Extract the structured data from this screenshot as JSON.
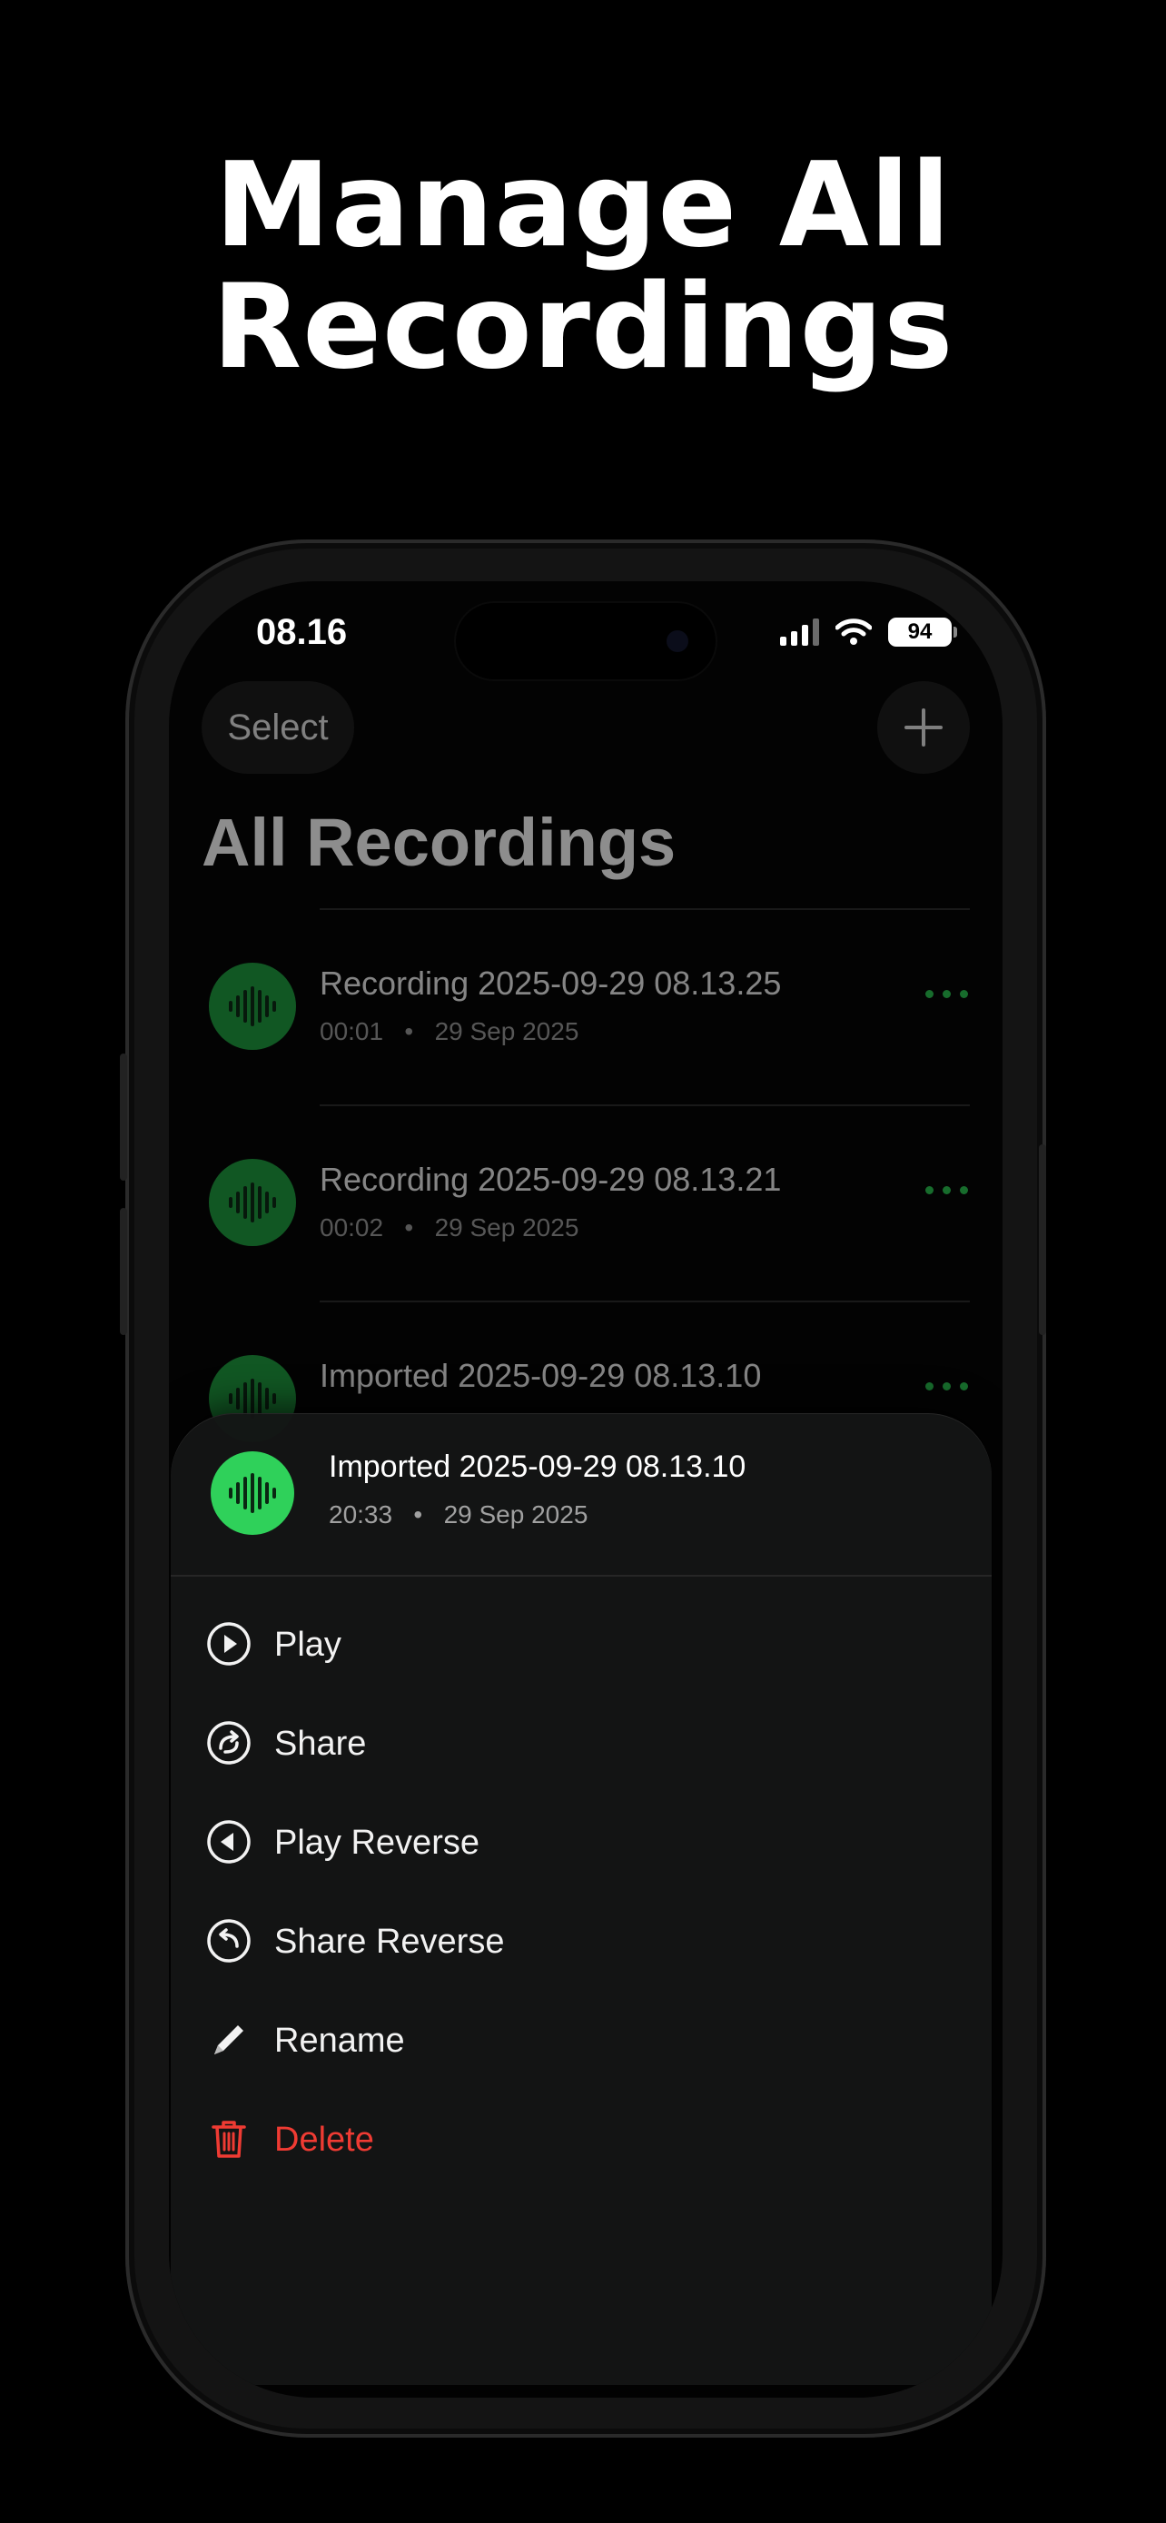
{
  "headline": {
    "line1": "Manage All",
    "line2": "Recordings"
  },
  "status_bar": {
    "time": "08.16",
    "battery": "94"
  },
  "toolbar": {
    "select_label": "Select"
  },
  "page_title": "All Recordings",
  "recordings": [
    {
      "title": "Recording 2025-09-29 08.13.25",
      "duration": "00:01",
      "separator": "•",
      "date": "29 Sep 2025"
    },
    {
      "title": "Recording 2025-09-29 08.13.21",
      "duration": "00:02",
      "separator": "•",
      "date": "29 Sep 2025"
    },
    {
      "title": "Imported 2025-09-29 08.13.10"
    }
  ],
  "context_sheet": {
    "title": "Imported 2025-09-29 08.13.10",
    "duration": "20:33",
    "separator": "•",
    "date": "29 Sep 2025",
    "actions": [
      {
        "label": "Play",
        "icon": "play-circle-icon"
      },
      {
        "label": "Share",
        "icon": "share-circle-icon"
      },
      {
        "label": "Play Reverse",
        "icon": "reverse-play-circle-icon"
      },
      {
        "label": "Share Reverse",
        "icon": "reverse-share-circle-icon"
      },
      {
        "label": "Rename",
        "icon": "pencil-icon"
      },
      {
        "label": "Delete",
        "icon": "trash-icon"
      }
    ]
  },
  "colors": {
    "accent_green": "#2fd15a",
    "avatar_green": "#1e9c3e",
    "danger_red": "#ef3b33",
    "background": "#000000"
  }
}
